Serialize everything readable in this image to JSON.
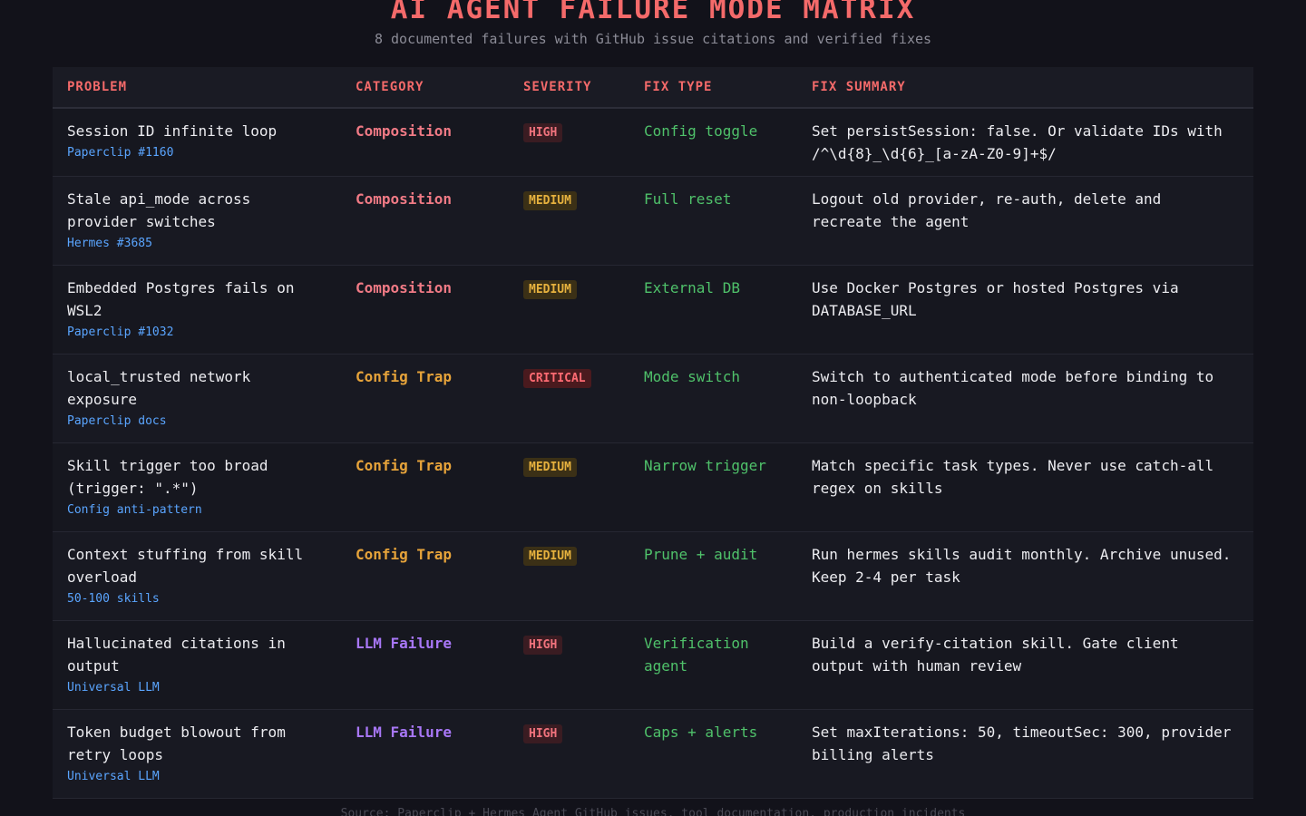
{
  "title": "AI AGENT FAILURE MODE MATRIX",
  "subtitle": "8 documented failures with GitHub issue citations and verified fixes",
  "headers": [
    "PROBLEM",
    "CATEGORY",
    "SEVERITY",
    "FIX TYPE",
    "FIX SUMMARY"
  ],
  "rows": [
    {
      "problem": "Session ID infinite loop",
      "citation": "Paperclip #1160",
      "category": "Composition",
      "severity": "HIGH",
      "fix_type": "Config toggle",
      "summary": "Set persistSession: false. Or validate IDs with /^\\d{8}_\\d{6}_[a-zA-Z0-9]+$/"
    },
    {
      "problem": "Stale api_mode across provider switches",
      "citation": "Hermes #3685",
      "category": "Composition",
      "severity": "MEDIUM",
      "fix_type": "Full reset",
      "summary": "Logout old provider, re-auth, delete and recreate the agent"
    },
    {
      "problem": "Embedded Postgres fails on WSL2",
      "citation": "Paperclip #1032",
      "category": "Composition",
      "severity": "MEDIUM",
      "fix_type": "External DB",
      "summary": "Use Docker Postgres or hosted Postgres via DATABASE_URL"
    },
    {
      "problem": "local_trusted network exposure",
      "citation": "Paperclip docs",
      "category": "Config Trap",
      "severity": "CRITICAL",
      "fix_type": "Mode switch",
      "summary": "Switch to authenticated mode before binding to non-loopback"
    },
    {
      "problem": "Skill trigger too broad (trigger: \".*\")",
      "citation": "Config anti-pattern",
      "category": "Config Trap",
      "severity": "MEDIUM",
      "fix_type": "Narrow trigger",
      "summary": "Match specific task types. Never use catch-all regex on skills"
    },
    {
      "problem": "Context stuffing from skill overload",
      "citation": "50-100 skills",
      "category": "Config Trap",
      "severity": "MEDIUM",
      "fix_type": "Prune + audit",
      "summary": "Run hermes skills audit monthly. Archive unused. Keep 2-4 per task"
    },
    {
      "problem": "Hallucinated citations in output",
      "citation": "Universal LLM",
      "category": "LLM Failure",
      "severity": "HIGH",
      "fix_type": "Verification agent",
      "summary": "Build a verify-citation skill. Gate client output with human review"
    },
    {
      "problem": "Token budget blowout from retry loops",
      "citation": "Universal LLM",
      "category": "LLM Failure",
      "severity": "HIGH",
      "fix_type": "Caps + alerts",
      "summary": "Set maxIterations: 50, timeoutSec: 300, provider billing alerts"
    }
  ],
  "footer": "Source: Paperclip + Hermes Agent GitHub issues, tool documentation, production incidents",
  "colors": {
    "accent": "#f46a6a",
    "composition": "#f07a85",
    "config_trap": "#e6a33a",
    "llm_failure": "#a877f7",
    "fix": "#4fc16a",
    "citation": "#5aa5ff"
  }
}
